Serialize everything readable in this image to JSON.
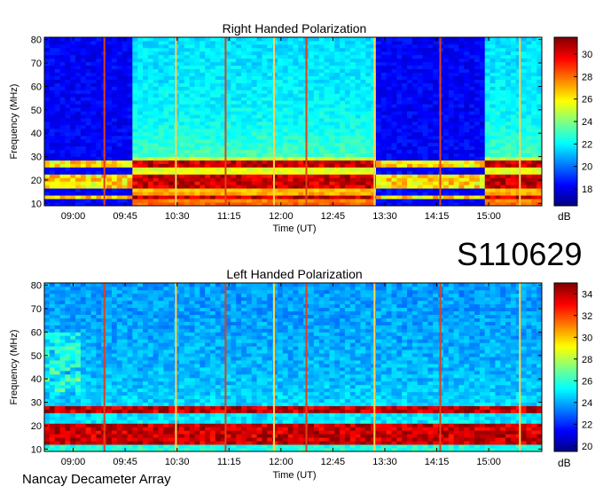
{
  "figure": {
    "event_id": "S110629",
    "instrument": "Nancay Decameter Array"
  },
  "chart_data": [
    {
      "type": "heatmap",
      "title": "Right Handed Polarization",
      "xlabel": "Time (UT)",
      "ylabel": "Frequency (MHz)",
      "x_ticks": [
        "09:00",
        "09:45",
        "10:30",
        "11:15",
        "12:00",
        "12:45",
        "13:30",
        "14:15",
        "15:00"
      ],
      "y_ticks": [
        10,
        20,
        30,
        40,
        50,
        60,
        70,
        80
      ],
      "ylim": [
        9,
        81
      ],
      "colorbar": {
        "label": "dB",
        "ticks": [
          18,
          20,
          22,
          24,
          26,
          28,
          30
        ],
        "range": [
          16.5,
          31.5
        ],
        "colormap": "jet"
      },
      "bright_bands_mhz": [
        13,
        17,
        18,
        20,
        21,
        26,
        27
      ],
      "vertical_lines_ut": [
        "09:27",
        "10:29",
        "11:12",
        "11:54",
        "12:22",
        "13:21",
        "14:18",
        "15:27"
      ],
      "quiet_intervals_ut": [
        [
          "08:35",
          "09:50"
        ],
        [
          "13:22",
          "14:55"
        ]
      ]
    },
    {
      "type": "heatmap",
      "title": "Left Handed Polarization",
      "xlabel": "Time (UT)",
      "ylabel": "Frequency (MHz)",
      "x_ticks": [
        "09:00",
        "09:45",
        "10:30",
        "11:15",
        "12:00",
        "12:45",
        "13:30",
        "14:15",
        "15:00"
      ],
      "y_ticks": [
        10,
        20,
        30,
        40,
        50,
        60,
        70,
        80
      ],
      "ylim": [
        9,
        81
      ],
      "colorbar": {
        "label": "dB",
        "ticks": [
          20,
          22,
          24,
          26,
          28,
          30,
          32,
          34
        ],
        "range": [
          19.5,
          35
        ],
        "colormap": "jet"
      },
      "bright_bands_mhz": [
        13,
        15,
        16,
        18,
        20,
        26,
        27
      ],
      "vertical_lines_ut": [
        "09:27",
        "10:29",
        "11:12",
        "11:54",
        "12:22",
        "13:21",
        "14:18",
        "15:27"
      ],
      "quiet_intervals_ut": []
    }
  ]
}
